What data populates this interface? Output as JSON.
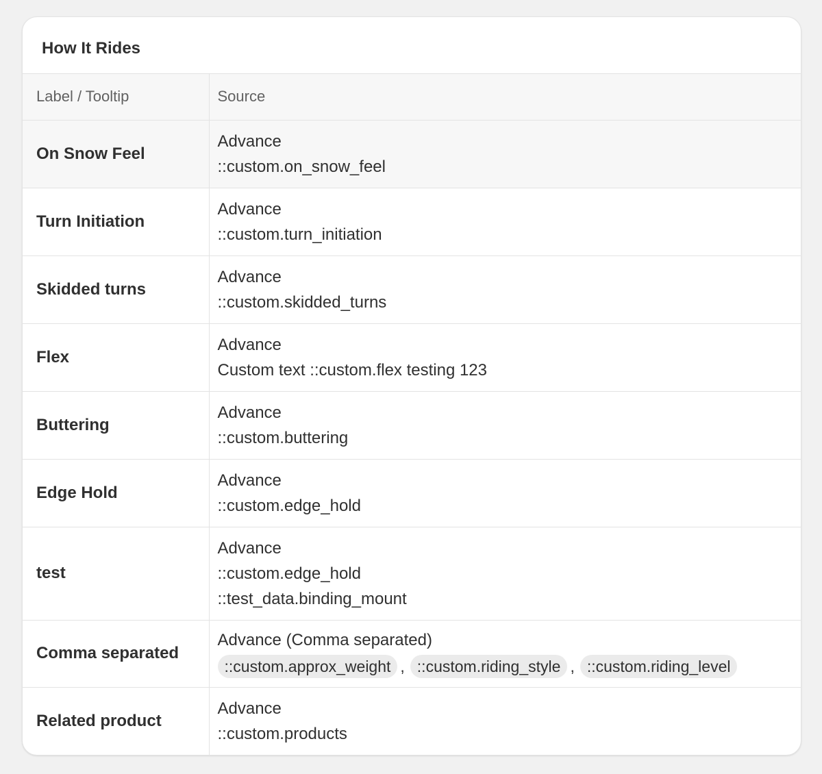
{
  "card": {
    "title": "How It Rides"
  },
  "table": {
    "headers": {
      "label": "Label / Tooltip",
      "source": "Source"
    },
    "rows": [
      {
        "label": "On Snow Feel",
        "lines": [
          "Advance",
          "::custom.on_snow_feel"
        ]
      },
      {
        "label": "Turn Initiation",
        "lines": [
          "Advance",
          "::custom.turn_initiation"
        ]
      },
      {
        "label": "Skidded turns",
        "lines": [
          "Advance",
          "::custom.skidded_turns"
        ]
      },
      {
        "label": "Flex",
        "lines": [
          "Advance",
          "Custom text ::custom.flex testing 123"
        ]
      },
      {
        "label": "Buttering",
        "lines": [
          "Advance",
          "::custom.buttering"
        ]
      },
      {
        "label": "Edge Hold",
        "lines": [
          "Advance",
          "::custom.edge_hold"
        ]
      },
      {
        "label": "test",
        "lines": [
          "Advance",
          "::custom.edge_hold",
          "::test_data.binding_mount"
        ]
      },
      {
        "label": "Comma separated",
        "lines": [
          "Advance (Comma separated)"
        ],
        "chips": [
          "::custom.approx_weight",
          "::custom.riding_style",
          "::custom.riding_level"
        ],
        "chip_separator": ","
      },
      {
        "label": "Related product",
        "lines": [
          "Advance",
          "::custom.products"
        ]
      }
    ]
  }
}
